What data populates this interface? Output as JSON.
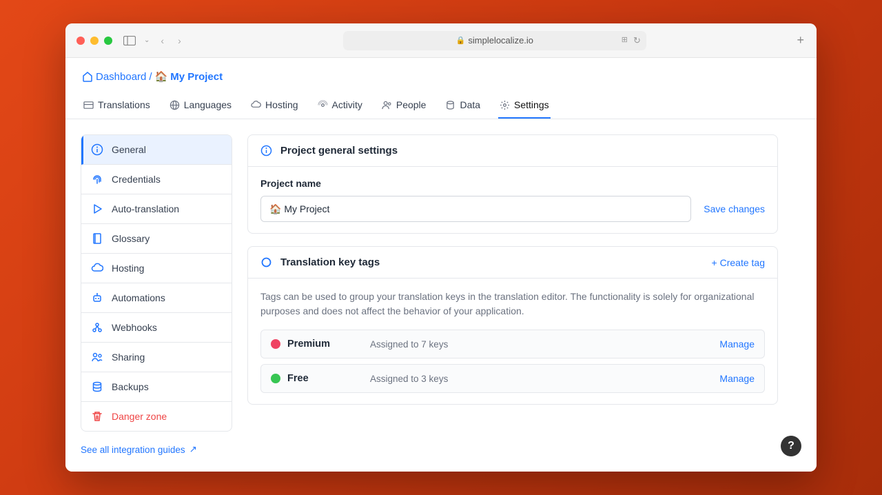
{
  "address_url": "simplelocalize.io",
  "breadcrumb": {
    "dashboard": "Dashboard",
    "separator": " / ",
    "project_emoji": "🏠",
    "project_name": "My Project"
  },
  "main_tabs": [
    {
      "label": "Translations"
    },
    {
      "label": "Languages"
    },
    {
      "label": "Hosting"
    },
    {
      "label": "Activity"
    },
    {
      "label": "People"
    },
    {
      "label": "Data"
    },
    {
      "label": "Settings"
    }
  ],
  "sidebar": {
    "items": [
      {
        "label": "General"
      },
      {
        "label": "Credentials"
      },
      {
        "label": "Auto-translation"
      },
      {
        "label": "Glossary"
      },
      {
        "label": "Hosting"
      },
      {
        "label": "Automations"
      },
      {
        "label": "Webhooks"
      },
      {
        "label": "Sharing"
      },
      {
        "label": "Backups"
      },
      {
        "label": "Danger zone"
      }
    ],
    "link": "See all integration guides"
  },
  "panel_general": {
    "title": "Project general settings",
    "field_label": "Project name",
    "field_value": "🏠 My Project",
    "save_label": "Save changes"
  },
  "panel_tags": {
    "title": "Translation key tags",
    "create_label": "Create tag",
    "help_text": "Tags can be used to group your translation keys in the translation editor. The functionality is solely for organizational purposes and does not affect the behavior of your application.",
    "tags": [
      {
        "name": "Premium",
        "assigned": "Assigned to 7 keys",
        "color": "#ef4363",
        "manage": "Manage"
      },
      {
        "name": "Free",
        "assigned": "Assigned to 3 keys",
        "color": "#37c653",
        "manage": "Manage"
      }
    ]
  },
  "help_fab": "?"
}
